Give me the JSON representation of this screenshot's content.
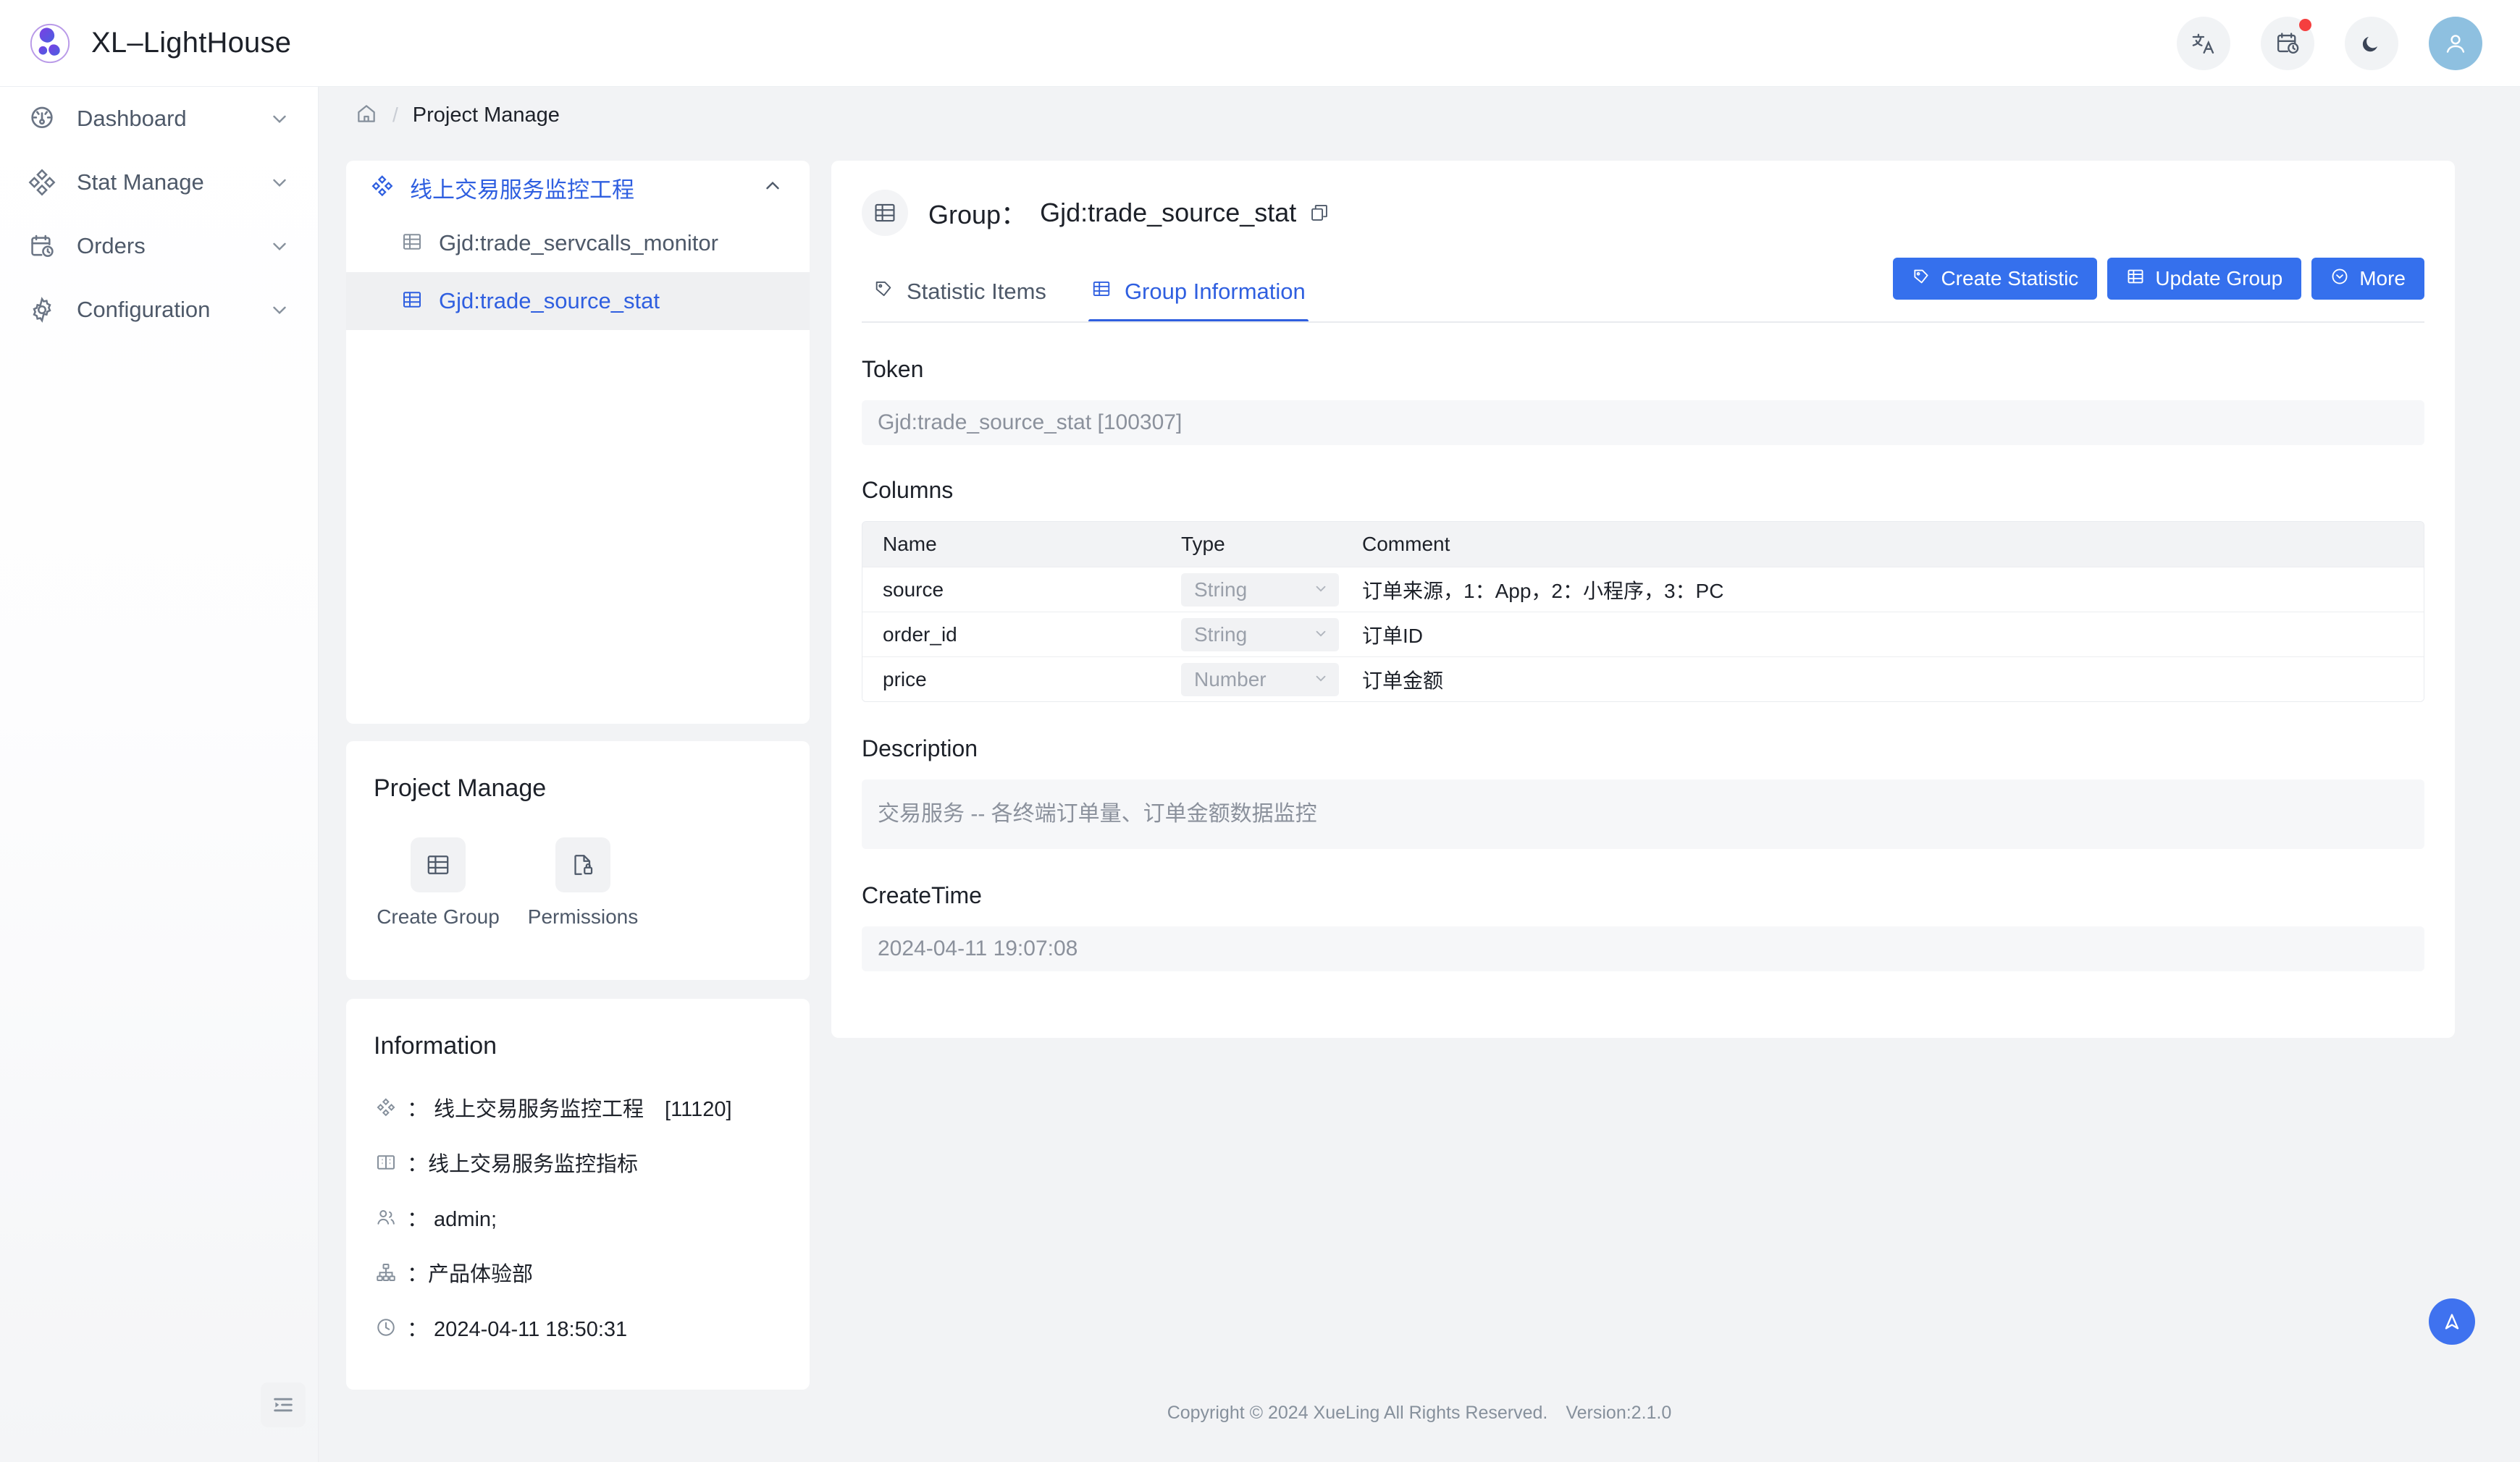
{
  "app": {
    "brand_name": "XL–LightHouse",
    "logo_icon": "lighthouse-logo-icon"
  },
  "topbar": {
    "actions": [
      {
        "name": "language-icon",
        "label": "Language"
      },
      {
        "name": "schedule-icon",
        "label": "Schedule",
        "badge": true
      },
      {
        "name": "moon-icon",
        "label": "Dark Mode"
      },
      {
        "name": "user-avatar-icon",
        "label": "Account"
      }
    ]
  },
  "sidebar": {
    "items": [
      {
        "label": "Dashboard",
        "icon": "dashboard-gauge-icon"
      },
      {
        "label": "Stat Manage",
        "icon": "diamonds-icon"
      },
      {
        "label": "Orders",
        "icon": "calendar-clock-icon"
      },
      {
        "label": "Configuration",
        "icon": "gear-icon"
      }
    ],
    "collapse_icon": "collapse-sidebar-icon"
  },
  "breadcrumb": {
    "home_icon": "home-icon",
    "separator": "/",
    "current": "Project Manage"
  },
  "tree": {
    "root": {
      "label": "线上交易服务监控工程",
      "icon": "diamonds-icon",
      "chevron": "chevron-up-icon"
    },
    "children": [
      {
        "label": "Gjd:trade_servcalls_monitor",
        "icon": "table-icon",
        "active": false
      },
      {
        "label": "Gjd:trade_source_stat",
        "icon": "table-icon",
        "active": true
      }
    ]
  },
  "project_manage": {
    "title": "Project Manage",
    "actions": [
      {
        "label": "Create Group",
        "icon": "table-icon"
      },
      {
        "label": "Permissions",
        "icon": "file-lock-icon"
      }
    ]
  },
  "information": {
    "title": "Information",
    "rows": [
      {
        "icon": "diamonds-icon",
        "text": "： 线上交易服务监控工程　[11120]"
      },
      {
        "icon": "book-icon",
        "text": "：线上交易服务监控指标"
      },
      {
        "icon": "users-icon",
        "text": "： admin;"
      },
      {
        "icon": "org-chart-icon",
        "text": "：产品体验部"
      },
      {
        "icon": "clock-icon",
        "text": "： 2024-04-11 18:50:31"
      }
    ]
  },
  "main": {
    "header_icon": "table-icon",
    "header_prefix": "Group：",
    "header_value": "Gjd:trade_source_stat",
    "copy_icon": "copy-icon",
    "tabs": [
      {
        "label": "Statistic Items",
        "icon": "tag-icon",
        "active": false
      },
      {
        "label": "Group Information",
        "icon": "table-icon",
        "active": true
      }
    ],
    "buttons": [
      {
        "label": "Create Statistic",
        "icon": "tag-icon"
      },
      {
        "label": "Update Group",
        "icon": "table-icon"
      },
      {
        "label": "More",
        "icon": "chevron-down-circle-icon"
      }
    ],
    "token": {
      "label": "Token",
      "value": "Gjd:trade_source_stat [100307]"
    },
    "columns": {
      "label": "Columns",
      "headers": [
        "Name",
        "Type",
        "Comment"
      ],
      "rows": [
        {
          "name": "source",
          "type": "String",
          "comment": "订单来源，1：App，2：小程序，3：PC"
        },
        {
          "name": "order_id",
          "type": "String",
          "comment": "订单ID"
        },
        {
          "name": "price",
          "type": "Number",
          "comment": "订单金额"
        }
      ]
    },
    "description": {
      "label": "Description",
      "value": "交易服务 -- 各终端订单量、订单金额数据监控"
    },
    "create_time": {
      "label": "CreateTime",
      "value": "2024-04-11 19:07:08"
    }
  },
  "footer": {
    "text": "Copyright © 2024 XueLing All Rights Reserved.　Version:2.1.0"
  },
  "fab": {
    "icon": "back-to-top-icon"
  },
  "colors": {
    "accent": "#3570ed",
    "link": "#2f5fe0",
    "page_bg": "#f2f3f5",
    "badge": "#f53f3f",
    "avatar": "#8ec0e0"
  }
}
